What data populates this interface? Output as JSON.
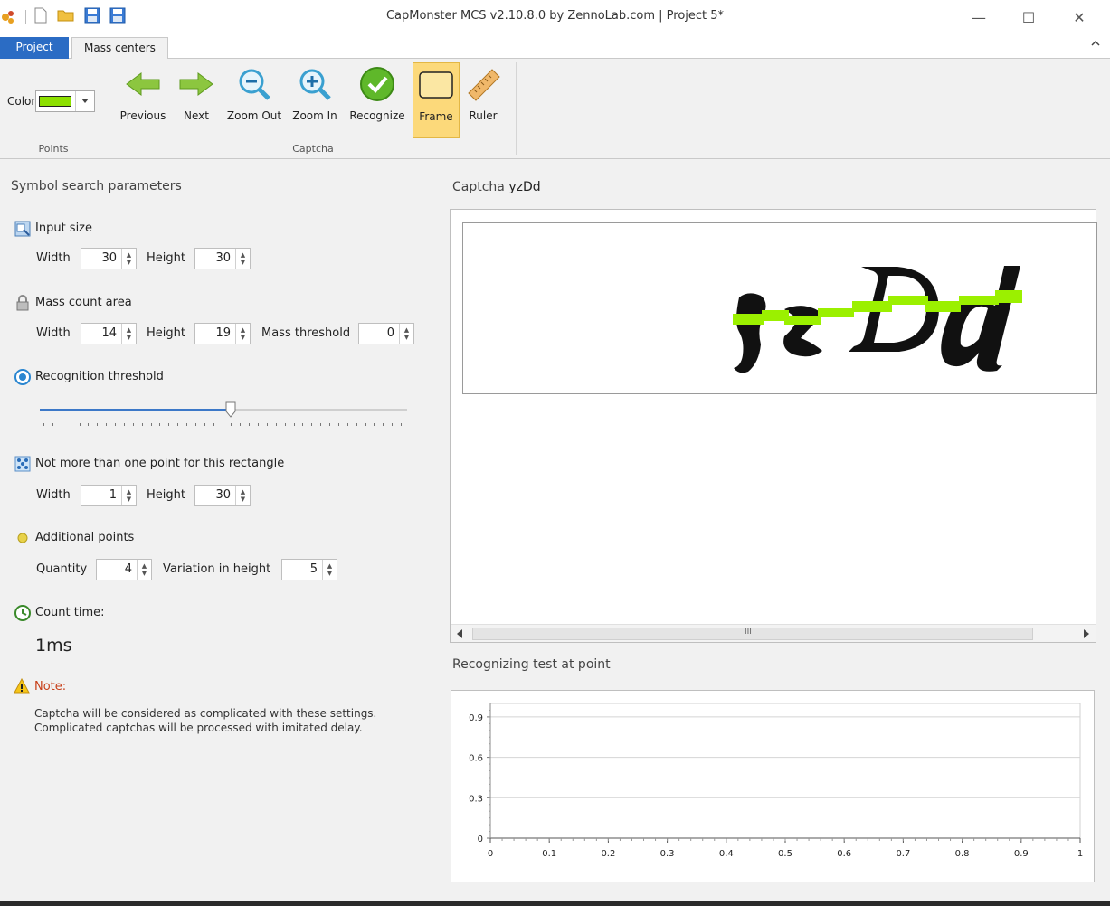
{
  "window": {
    "title": "CapMonster MCS v2.10.8.0 by ZennoLab.com | Project 5*",
    "minimize": "—",
    "maximize": "☐",
    "close": "✕"
  },
  "tabs": [
    {
      "label": "Project",
      "active": false
    },
    {
      "label": "Mass centers",
      "active": true
    }
  ],
  "ribbon": {
    "points_group": {
      "label": "Points",
      "color_label": "Color",
      "color_value": "#8de000"
    },
    "captcha_group": {
      "label": "Captcha",
      "buttons": [
        {
          "label": "Previous",
          "icon": "arrow-left-icon"
        },
        {
          "label": "Next",
          "icon": "arrow-right-icon"
        },
        {
          "label": "Zoom Out",
          "icon": "zoom-out-icon"
        },
        {
          "label": "Zoom In",
          "icon": "zoom-in-icon"
        },
        {
          "label": "Recognize",
          "icon": "check-circle-icon"
        },
        {
          "label": "Frame",
          "icon": "frame-icon",
          "active": true
        },
        {
          "label": "Ruler",
          "icon": "ruler-icon"
        }
      ]
    }
  },
  "left": {
    "section_title": "Symbol search parameters",
    "input_size": {
      "title": "Input size",
      "width_label": "Width",
      "width": "30",
      "height_label": "Height",
      "height": "30"
    },
    "mass_count": {
      "title": "Mass count area",
      "width_label": "Width",
      "width": "14",
      "height_label": "Height",
      "height": "19",
      "threshold_label": "Mass threshold",
      "threshold": "0"
    },
    "recognition": {
      "title": "Recognition threshold",
      "level": 0.52
    },
    "rectangle": {
      "title": "Not more than one point for this rectangle",
      "width_label": "Width",
      "width": "1",
      "height_label": "Height",
      "height": "30"
    },
    "additional": {
      "title": "Additional points",
      "quantity_label": "Quantity",
      "quantity": "4",
      "variation_label": "Variation in height",
      "variation": "5"
    },
    "count_time": {
      "title": "Count time:",
      "value": "1ms"
    },
    "note": {
      "title": "Note:",
      "line1": "Captcha will be considered as complicated with these settings.",
      "line2": "Complicated captchas will be processed with imitated delay."
    }
  },
  "right": {
    "captcha_label": "Captcha",
    "captcha_value": "yzDd",
    "scroll_grip": "III",
    "recog_title": "Recognizing test at point"
  },
  "chart_data": {
    "type": "line",
    "title": "",
    "xlabel": "",
    "ylabel": "",
    "xlim": [
      0,
      1
    ],
    "ylim": [
      0,
      1
    ],
    "x_ticks": [
      "0",
      "0.1",
      "0.2",
      "0.3",
      "0.4",
      "0.5",
      "0.6",
      "0.7",
      "0.8",
      "0.9",
      "1"
    ],
    "y_ticks": [
      "0",
      "0.3",
      "0.6",
      "0.9"
    ],
    "grid": true,
    "series": []
  },
  "colors": {
    "accent": "#2b6cc4",
    "active_button": "#fcd97a",
    "points": "#8de000"
  }
}
